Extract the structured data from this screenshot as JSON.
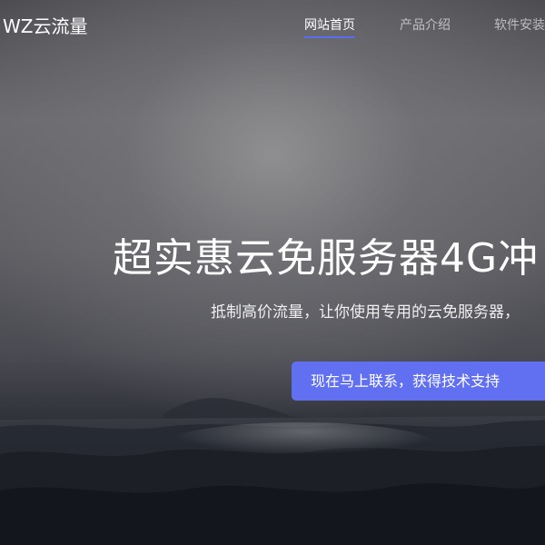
{
  "header": {
    "logo_text": "WZ云流量",
    "nav": [
      {
        "label": "网站首页",
        "active": true
      },
      {
        "label": "产品介绍",
        "active": false
      },
      {
        "label": "软件安装",
        "active": false
      }
    ]
  },
  "hero": {
    "title": "超实惠云免服务器4G冲",
    "subtitle": "抵制高价流量，让你使用专用的云免服务器，",
    "cta_label": "现在马上联系，获得技术支持"
  },
  "colors": {
    "accent": "#5b6cf2",
    "button_bg": "#6170f1",
    "text": "#ffffff"
  }
}
